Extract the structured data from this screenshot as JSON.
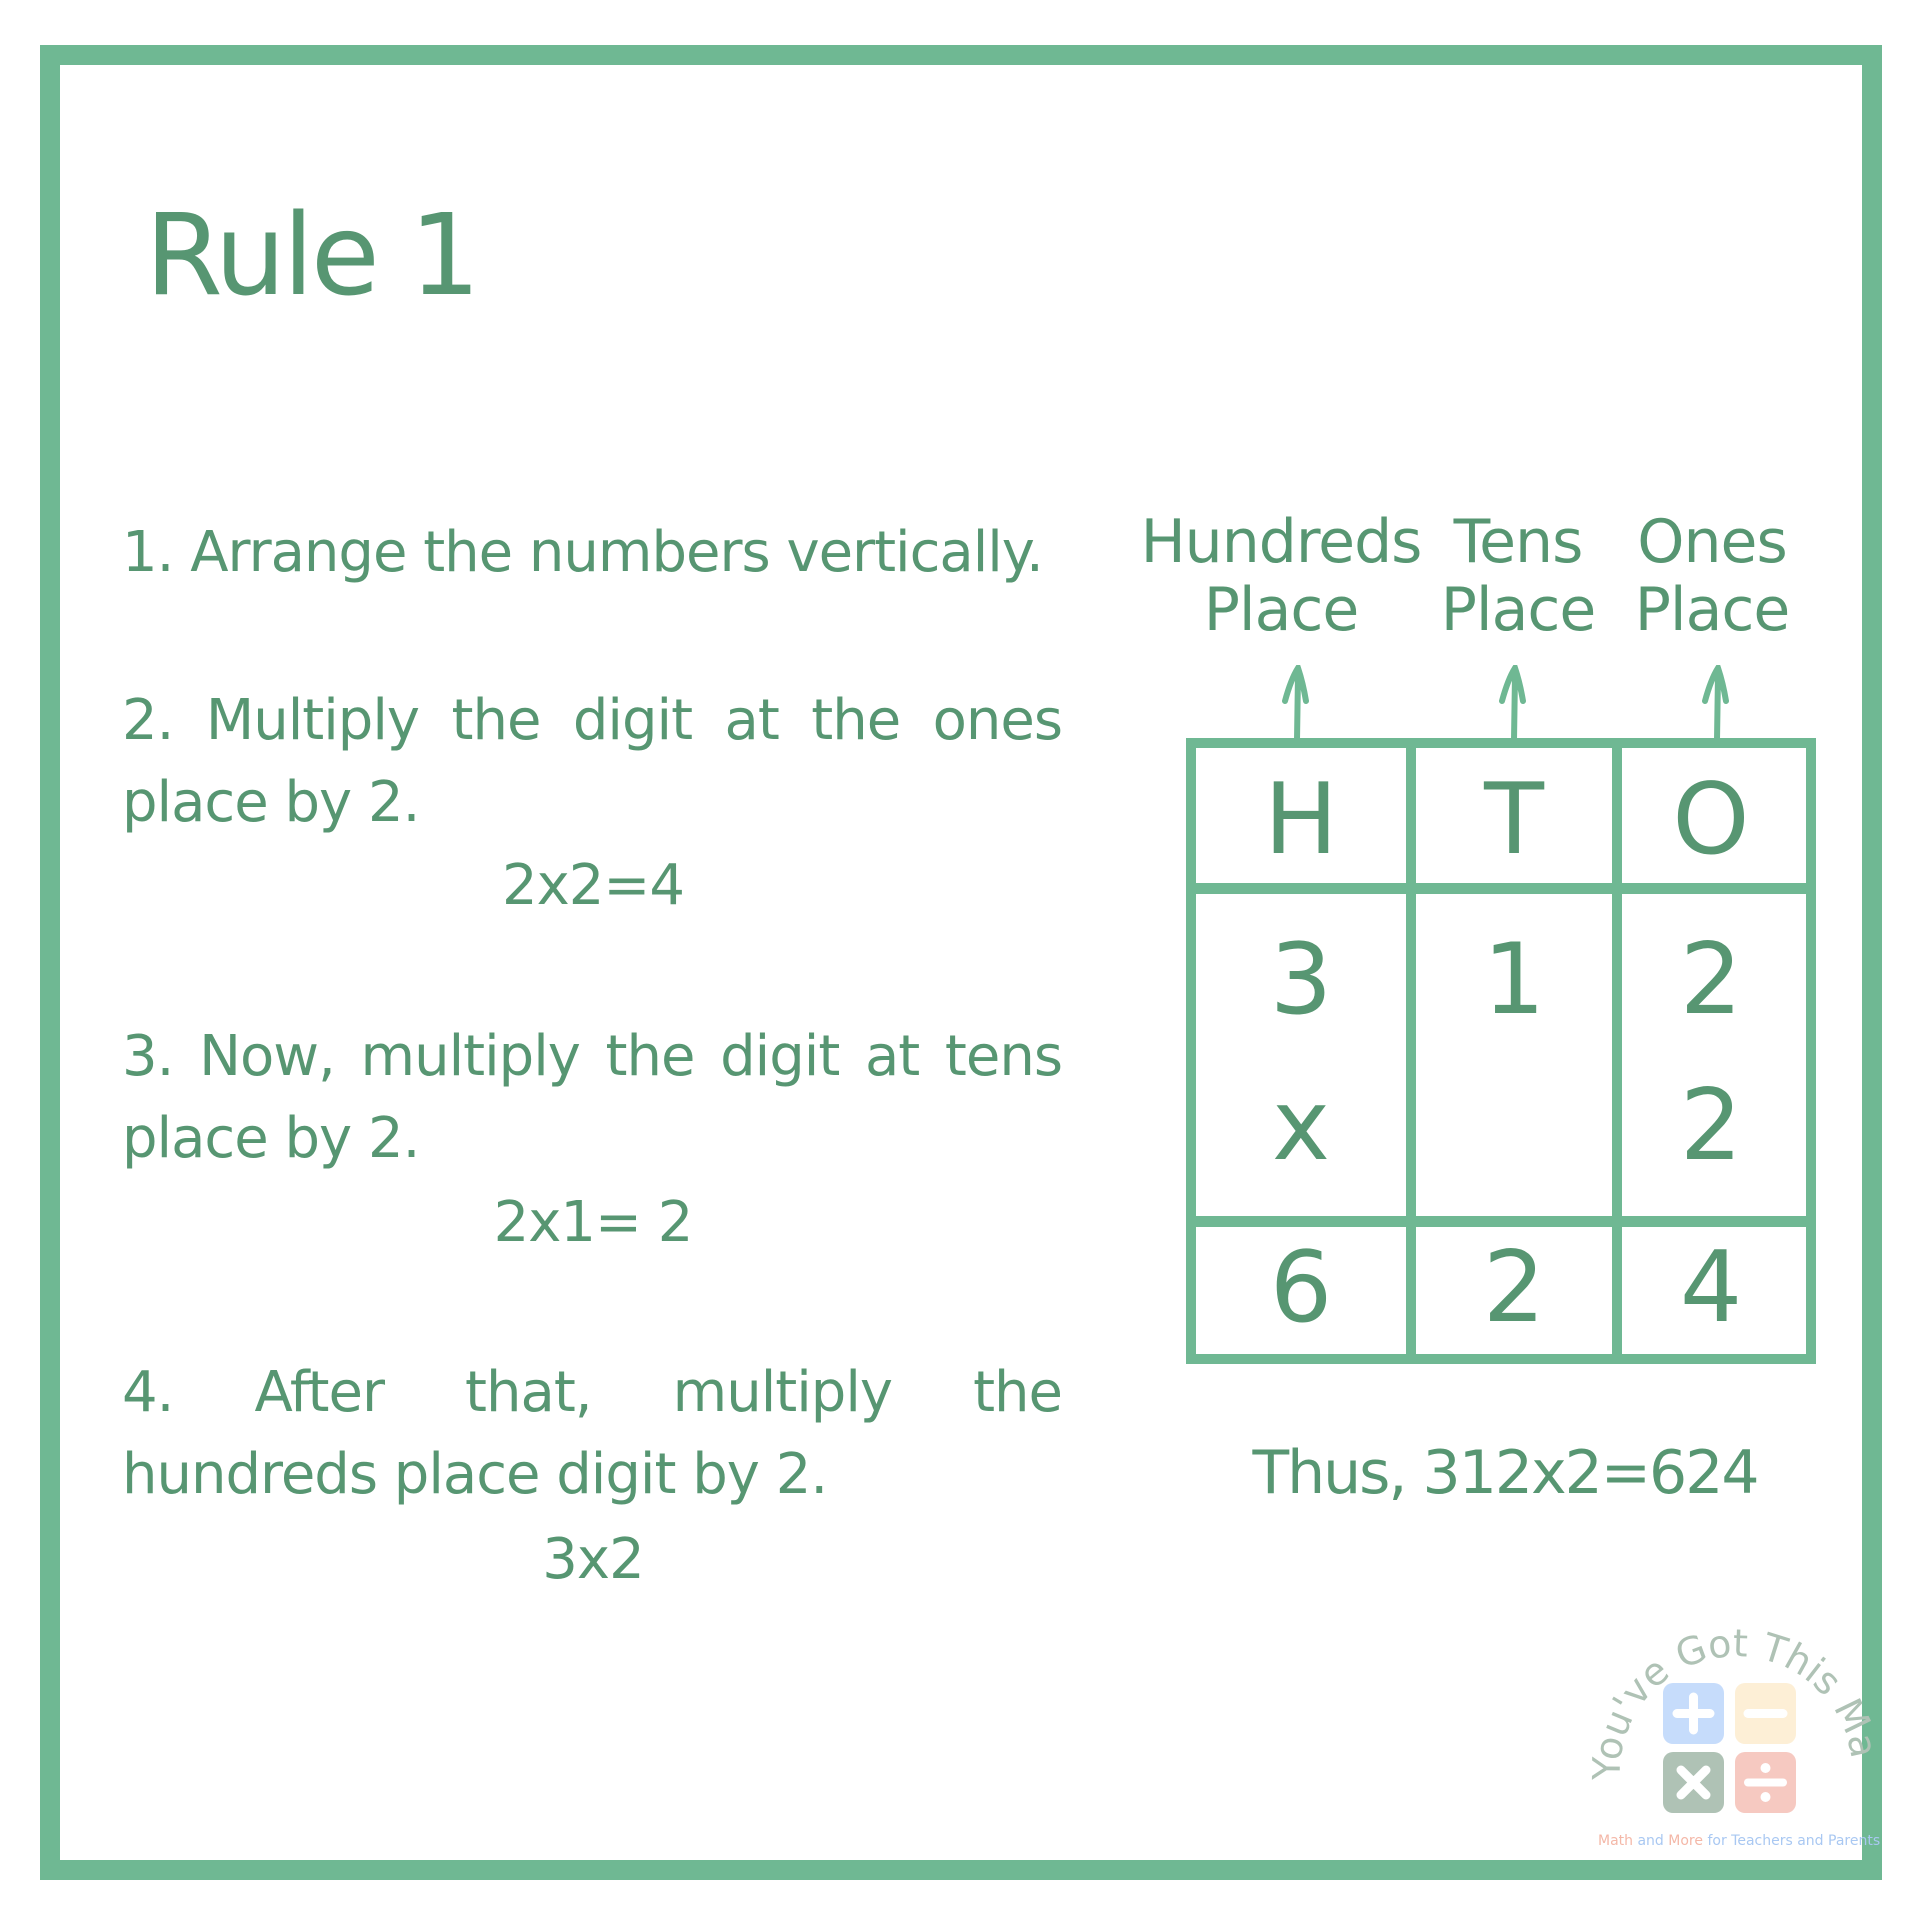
{
  "title": "Rule 1",
  "steps": [
    {
      "text": "1. Arrange the numbers vertically."
    },
    {
      "text": "2. Multiply the digit at the ones place by 2.",
      "calc": "2x2=4"
    },
    {
      "text": "3. Now, multiply the digit at tens place by 2.",
      "calc": "2x1= 2"
    },
    {
      "text": "4. After that, multiply the hundreds place digit by 2.",
      "calc": "3x2"
    }
  ],
  "place_headers": [
    {
      "line1": "Hundreds",
      "line2": "Place"
    },
    {
      "line1": "Tens",
      "line2": "Place"
    },
    {
      "line1": "Ones",
      "line2": "Place"
    }
  ],
  "table": {
    "header": [
      "H",
      "T",
      "O"
    ],
    "multiplicand": [
      "3",
      "1",
      "2"
    ],
    "multiplier": [
      "x",
      "",
      "2"
    ],
    "product": [
      "6",
      "2",
      "4"
    ]
  },
  "conclusion": "Thus, 312x2=624",
  "logo": {
    "arc_text": "You've Got This Math",
    "tagline_parts": [
      "Math",
      " and ",
      "More",
      " for ",
      "Teachers",
      " and ",
      "Parents"
    ],
    "icons": [
      "plus-icon",
      "minus-icon",
      "times-icon",
      "divide-icon"
    ]
  },
  "colors": {
    "border": "#6fb893",
    "text": "#579672",
    "logo_blue": "#c6dcfb",
    "logo_cream": "#fdefd6",
    "logo_gray": "#afc2b5",
    "logo_pink": "#f6c9c1"
  }
}
